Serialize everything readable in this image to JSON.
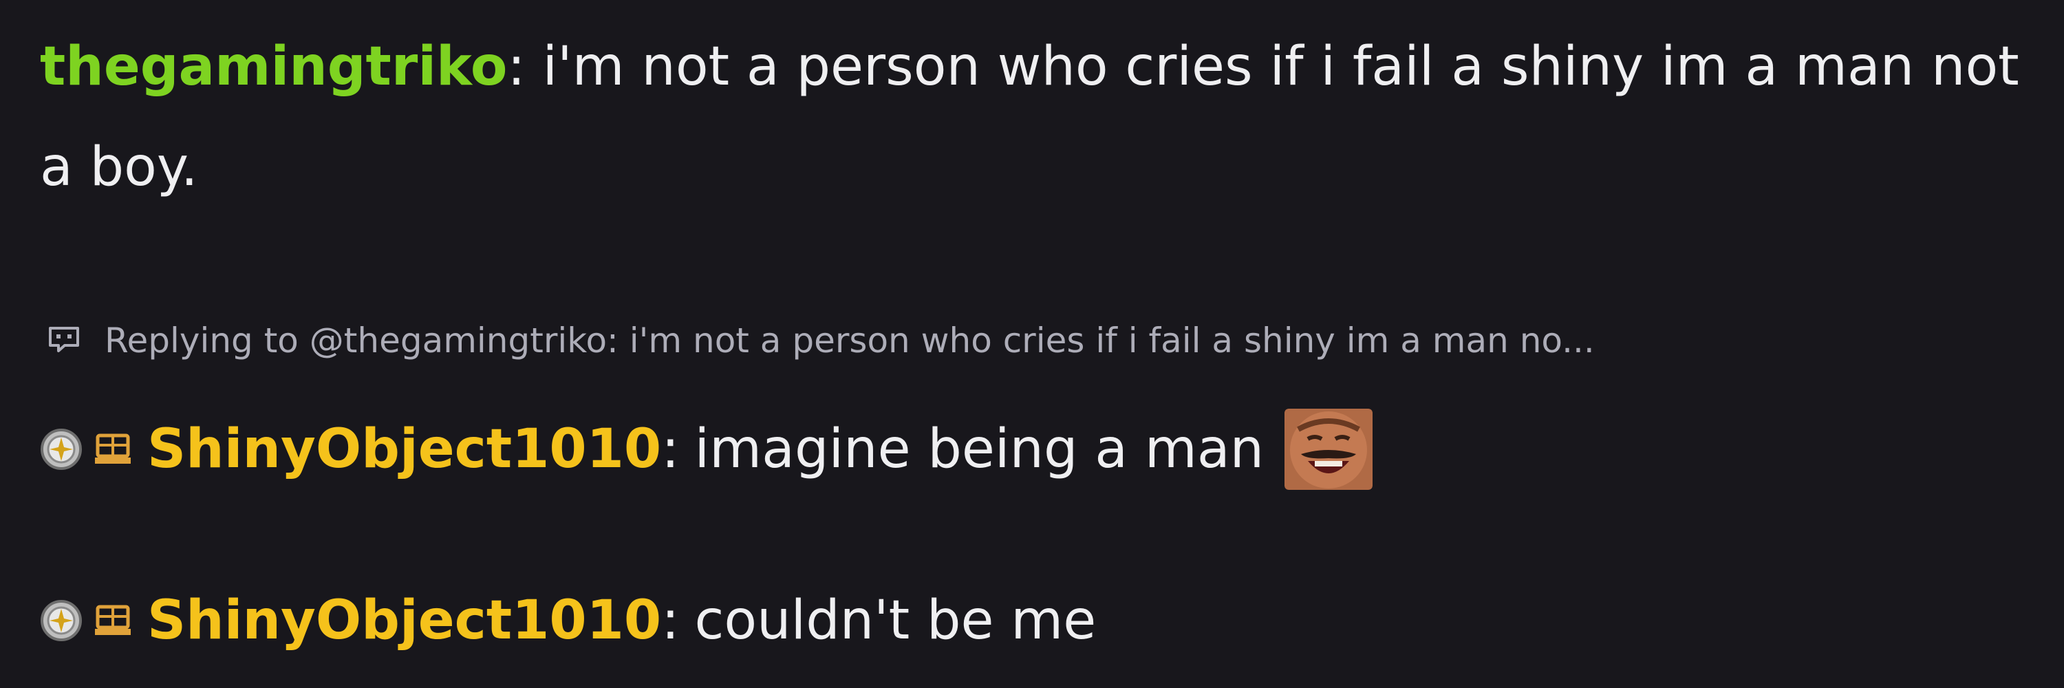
{
  "messages": [
    {
      "username": "thegamingtriko",
      "username_color": "#7ed321",
      "text": "i'm not a person who cries if i fail a shiny im a man not a boy."
    },
    {
      "reply_label": "Replying to @thegamingtriko: i'm not a person who cries if i fail a shiny im a man no...",
      "reply_icon": "reply-bubble-icon",
      "badges": [
        "prediction-badge-icon",
        "bits-badge-icon"
      ],
      "username": "ShinyObject1010",
      "username_color": "#f5c21b",
      "text": "imagine being a man",
      "emote": "laughing-man-emote"
    },
    {
      "badges": [
        "prediction-badge-icon",
        "bits-badge-icon"
      ],
      "username": "ShinyObject1010",
      "username_color": "#f5c21b",
      "text": "couldn't be me"
    }
  ],
  "colors": {
    "background": "#18171c",
    "text": "#efeff1",
    "reply_text": "#adadb8"
  },
  "separator": ":"
}
